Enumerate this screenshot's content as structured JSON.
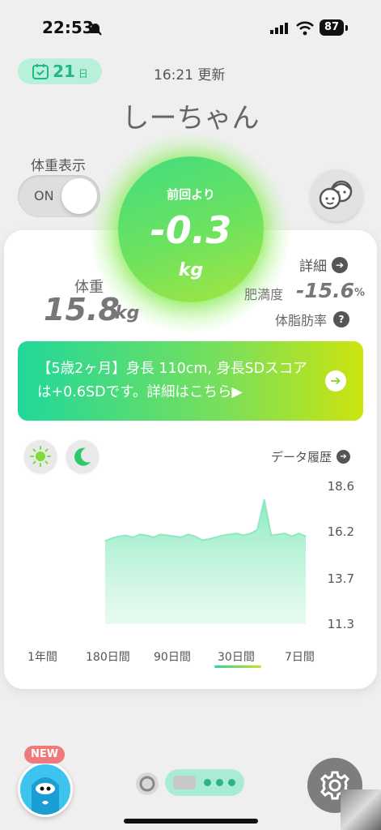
{
  "status_bar": {
    "time": "22:53",
    "battery": "87"
  },
  "header": {
    "day_count": "21",
    "day_unit": "日",
    "updated": "16:21 更新",
    "child_name": "しーちゃん"
  },
  "weight_display": {
    "label": "体重表示",
    "toggle_text": "ON"
  },
  "change": {
    "label": "前回より",
    "value": "-0.3",
    "unit": "kg"
  },
  "weight": {
    "label": "体重",
    "value": "15.8",
    "unit": "kg"
  },
  "details": {
    "label": "詳細",
    "obesity_label": "肥満度",
    "obesity_value": "-15.6",
    "obesity_unit": "%",
    "bodyfat_label": "体脂肪率"
  },
  "banner": {
    "text": "【5歳2ヶ月】身長 110cm, 身長SDスコアは+0.6SDです。詳細はこちら▶"
  },
  "history": {
    "label": "データ履歴"
  },
  "chart_data": {
    "type": "area",
    "ylim": [
      11.3,
      18.6
    ],
    "yticks": [
      "18.6",
      "16.2",
      "13.7",
      "11.3"
    ],
    "x": [
      1,
      2,
      3,
      4,
      5,
      6,
      7,
      8,
      9,
      10,
      11,
      12,
      13,
      14,
      15,
      16,
      17,
      18,
      19,
      20,
      21,
      22,
      23,
      24,
      25,
      26,
      27,
      28,
      29,
      30
    ],
    "values": [
      15.7,
      15.85,
      15.95,
      16.0,
      15.9,
      16.05,
      16.0,
      15.9,
      16.05,
      16.0,
      15.95,
      15.9,
      16.05,
      15.95,
      15.75,
      15.8,
      15.9,
      16.0,
      16.05,
      16.1,
      16.0,
      16.1,
      16.3,
      17.9,
      16.0,
      16.05,
      16.1,
      15.95,
      16.1,
      15.95
    ]
  },
  "ranges": [
    "1年間",
    "180日間",
    "90日間",
    "30日間",
    "7日間"
  ],
  "bottom": {
    "new_badge": "NEW"
  }
}
